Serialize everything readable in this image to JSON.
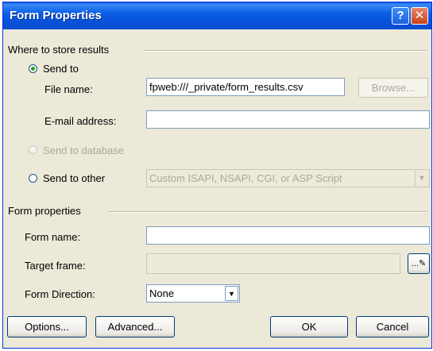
{
  "window": {
    "title": "Form Properties"
  },
  "titlebar": {
    "help_glyph": "?",
    "close_glyph": "✕"
  },
  "store": {
    "group_label": "Where to store results",
    "send_to_label": "Send to",
    "file_name_label": "File name:",
    "file_name_value": "fpweb:///_private/form_results.csv",
    "browse_label": "Browse...",
    "email_label": "E-mail address:",
    "email_value": "",
    "send_db_label": "Send to database",
    "send_other_label": "Send to other",
    "other_options_value": "Custom ISAPI, NSAPI, CGI, or ASP Script"
  },
  "props": {
    "group_label": "Form properties",
    "form_name_label": "Form name:",
    "form_name_value": "",
    "target_frame_label": "Target frame:",
    "target_frame_value": "",
    "direction_label": "Form Direction:",
    "direction_value": "None"
  },
  "buttons": {
    "options": "Options...",
    "advanced": "Advanced...",
    "ok": "OK",
    "cancel": "Cancel"
  },
  "icons": {
    "pencil_button_glyph": "...✎"
  }
}
